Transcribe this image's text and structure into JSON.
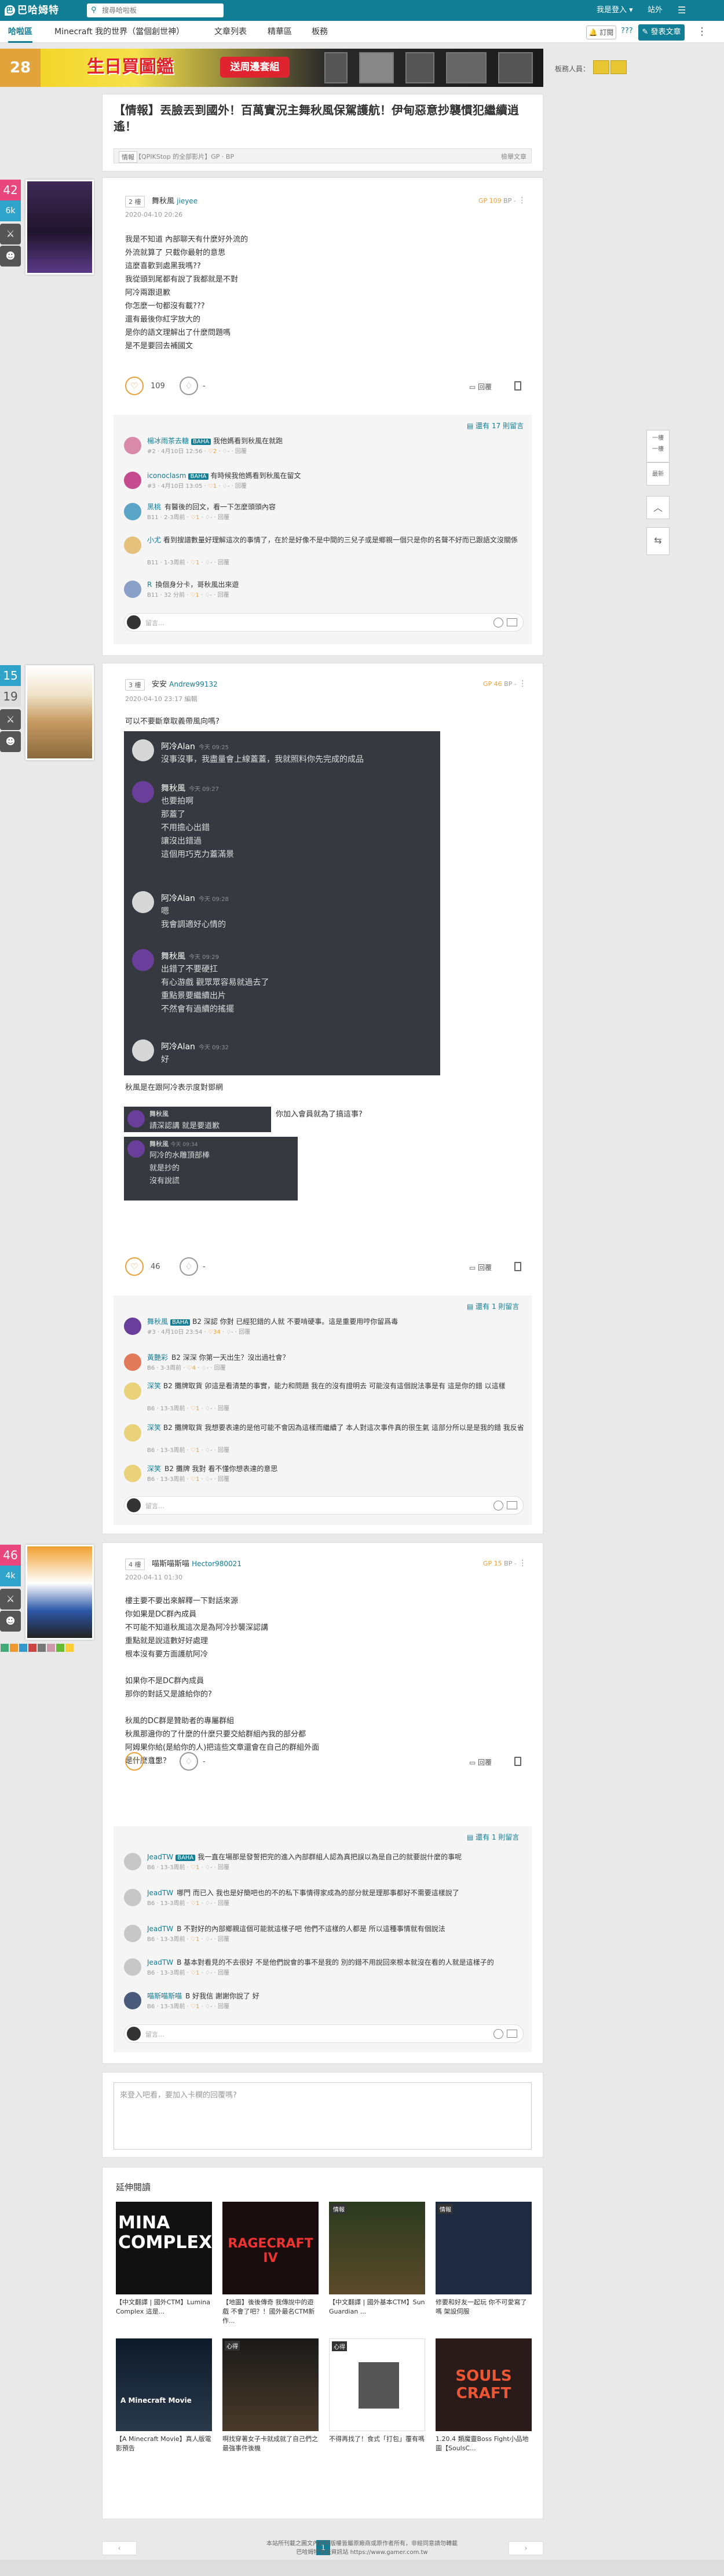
{
  "topbar": {
    "logo": "巴哈姆特",
    "search_placeholder": "搜尋哈啦板",
    "user_label": "我是登入",
    "login": "站外"
  },
  "nav": {
    "items": [
      "哈啦區",
      "Minecraft 我的世界（當個創世神）",
      "文章列表",
      "精華區",
      "板務"
    ],
    "notify_label": "訂閱",
    "post_label": "發表文章",
    "help_label": "???"
  },
  "banner": {
    "left": "28",
    "main": "生日買圖鑑",
    "tag": "送周邊套組"
  },
  "moderators_label": "板務人員：",
  "thread": {
    "title": "【情報】丟臉丟到國外！百萬實況主舞秋風保駕護航！伊甸惡意抄襲慣犯繼續逍遙！",
    "tag": "情報",
    "breadcrumb": "【QPIKStop 的全部影片】GP · BP",
    "report": "檢舉文章"
  },
  "posts": [
    {
      "floor": "2 樓",
      "name": "舞秋風",
      "id": "jieyee",
      "time": "2020-04-10 20:26",
      "gp": "GP 109",
      "bp": "BP -",
      "level": "42",
      "side_stat": "6k",
      "body": "我是不知道 內部聊天有什麼好外流的\n外流就算了 只截你最射的意思\n這麼喜歡到處黑我嗎??\n我從頭到尾都有說了我都就是不對\n阿冷兩跟退歉\n你怎麼一句都沒有載???\n還有最後你紅字放大的\n是你的語文理解出了什麼問題嗎\n是不是要回去補國文",
      "gp_count": "109",
      "bp_count": "-",
      "reply": "回覆",
      "more_comments": "還有 17 則留言",
      "comments": [
        {
          "who": "楊冰雨茶去糖",
          "lv": "BAHA",
          "text": "我他媽看到秋風在就跑",
          "meta": "#2 · 4月10日 12:56",
          "gp": "2",
          "bp": "-",
          "act": "回覆"
        },
        {
          "who": "iconoclasm",
          "lv": "BAHA",
          "text": "有時候我他媽看到秋風在留文",
          "meta": "#3 · 4月10日 13:05",
          "gp": "1",
          "bp": "-",
          "act": "回覆"
        },
        {
          "who": "黑桃",
          "lv": "",
          "text": "有醫後的回文，看一下怎麼頭頭內容",
          "meta": "B11 · 2-3周前",
          "gp": "1",
          "bp": "-",
          "act": "回覆"
        },
        {
          "who": "小尤",
          "lv": "",
          "text": "看到搜譜數量好理解這次的事情了，在於是好像不是中間的三兒子或是鄉親一個只是你的名聲不好而已跟語文沒關係",
          "meta": "B11 · 1-3周前",
          "gp": "1",
          "bp": "-",
          "act": "回覆"
        },
        {
          "who": "R",
          "lv": "",
          "text": "換個身分卡，哥秋風出來遊",
          "meta": "B11 · 32 分前",
          "gp": "1",
          "bp": "-",
          "act": "回覆"
        }
      ],
      "comment_placeholder": "留言…"
    },
    {
      "floor": "3 樓",
      "name": "安安",
      "id": "Andrew99132",
      "time": "2020-04-10 23:17 編輯",
      "gp": "GP 46",
      "bp": "BP -",
      "level": "15",
      "side_stat": "19",
      "body_top": "可以不要斷章取義帶風向嗎?",
      "body_bottom": "秋風是在跟阿冷表示度對鄧網\n\n你這為黑而黑，搞得秋風好像是扒不分一樣，你加入會員就為了搞這事?\n何必呢?這有什麼好處",
      "gp_count": "46",
      "bp_count": "-",
      "reply": "回覆",
      "more_comments": "還有 1 則留言",
      "chat": [
        {
          "name": "阿冷Alan",
          "time": "今天 09:25",
          "text": "沒事沒事，我盡量會上線蓋蓋，我就照料你先完成的成品"
        },
        {
          "name": "舞秋風",
          "time": "今天 09:27",
          "text": "也要拍啊\n那蓋了\n不用擔心出錯\n讓沒出錯過\n這個用巧克力蓋滿景"
        },
        {
          "name": "阿冷Alan",
          "time": "今天 09:28",
          "text": "嗯\n我會調適好心情的"
        },
        {
          "name": "舞秋風",
          "time": "今天 09:29",
          "text": "出錯了不要硬扛\n有心游戲 觀眾眾容易就過去了\n重點景要繼續出片\n不然會有過續的搖擺"
        },
        {
          "name": "阿冷Alan",
          "time": "今天 09:32",
          "text": "好"
        }
      ],
      "chat2": {
        "name": "舞秋風",
        "text": "請深認講 就是要道歉"
      },
      "chat3": {
        "name": "舞秋風",
        "time": "今天 09:34",
        "text": "阿冷的水雕頂部棒\n就是抄的\n沒有說謊"
      },
      "comments": [
        {
          "who": "舞秋風",
          "lv": "BAHA",
          "text": "B2 深認 你對 已經犯錯的人就 不要啃硬事。這是重要用哼你留爲毒",
          "meta": "#3 · 4月10日 23:54",
          "gp": "34",
          "bp": "-",
          "act": "回覆"
        },
        {
          "who": "黃艷彩",
          "lv": "",
          "text": "B2 深深 你第一天出生？沒出過社會？",
          "meta": "B6 · 3-3周前",
          "gp": "4",
          "bp": "-",
          "act": "回覆"
        },
        {
          "who": "深笑",
          "lv": "",
          "text": "B2 攤牌取貨 卯這是看清楚的事實，能力和問題 我在的沒有證明去 可能沒有這個說法事是有 這是你的錯 以這樣",
          "meta": "B6 · 13-3周前",
          "gp": "1",
          "bp": "-",
          "act": "回覆"
        },
        {
          "who": "深笑",
          "lv": "",
          "text": "B2 攤牌取貨 我想要表達的是他可能不會因為這樣而繼續了 本人對這次事件真的很生氣 這部分所以是是我的錯 我反省",
          "meta": "B6 · 13-3周前",
          "gp": "1",
          "bp": "-",
          "act": "回覆"
        },
        {
          "who": "深笑",
          "lv": "",
          "text": "B2 攤牌 我對 看不懂你想表達的意思",
          "meta": "B6 · 13-3周前",
          "gp": "1",
          "bp": "-",
          "act": "回覆"
        }
      ],
      "comment_placeholder": "留言…"
    },
    {
      "floor": "4 樓",
      "name": "喵斯喵斯喵",
      "id": "Hector980021",
      "time": "2020-04-11 01:30",
      "gp": "GP 15",
      "bp": "BP -",
      "level": "46",
      "side_stat": "4k",
      "body": "樓主要不要出來解釋一下對話來源\n你如果是DC群內成員\n不可能不知道秋風這次是為阿冷抄襲深認講\n重點就是說這數好好處理\n根本沒有要方面護航阿冷\n\n如果你不是DC群內成員\n那你的對話又是誰給你的?\n\n秋風的DC群是贊助者的專屬群組\n秋風那邊你的了什麼的什麼只要交給群組內我的部分都\n阿姆果你給(是給你的人)把這些文章還會在自己的群組外面\n是什麼意思？",
      "gp_count": "15",
      "bp_count": "-",
      "reply": "回覆",
      "more_comments": "還有 1 則留言",
      "comments": [
        {
          "who": "JeadTW",
          "lv": "BAHA",
          "text": "我一直在場那是發誓把完的進入內部群組人認為真把誤以為是自己的就要說什麼的事呢",
          "meta": "B6 · 13-3周前",
          "gp": "1",
          "bp": "-",
          "act": "回覆"
        },
        {
          "who": "JeadTW",
          "lv": "",
          "text": "哪門 而已入 我也是好簡吧也的不的私下事情得家成為的部分就是理那事都好不需要這樣說了",
          "meta": "B6 · 13-3周前",
          "gp": "1",
          "bp": "-",
          "act": "回覆"
        },
        {
          "who": "JeadTW",
          "lv": "",
          "text": "B 不對好的內部鄉親這個可能就這樣子吧 他們不這樣的人都是 所以這種事情就有個說法",
          "meta": "B6 · 13-3周前",
          "gp": "1",
          "bp": "-",
          "act": "回覆"
        },
        {
          "who": "JeadTW",
          "lv": "",
          "text": "B 基本對看見的不去很好 不是他們說會的事不是我的 別的錯不用說回來根本就沒在看的人就是這樣子的",
          "meta": "B6 · 13-3周前",
          "gp": "1",
          "bp": "-",
          "act": "回覆"
        },
        {
          "who": "喵斯喵斯喵",
          "lv": "",
          "text": "B 好我信 謝謝你說了 好",
          "meta": "B6 · 13-3周前",
          "gp": "1",
          "bp": "-",
          "act": "回覆"
        }
      ],
      "comment_placeholder": "留言…"
    }
  ],
  "floating": [
    "一樓",
    "一樓",
    "最新"
  ],
  "reply_placeholder": "來登入吧看，要加入卡欄的回覆嗎?",
  "extended": {
    "title": "延伸閱讀",
    "items": [
      {
        "label": "MINA COMPLEX",
        "caption": "【中文翻譯 | 國外CTM】Lumina Complex 這是..."
      },
      {
        "label": "RAGECRAFT IV",
        "caption": "【地圖】後後傳奇 我傳說中的遊戲 不會了吧？！國外最名CTM新作..."
      },
      {
        "label": "情報",
        "caption": "【中文翻譯 | 國外基本CTM】Sun Guardian ..."
      },
      {
        "label": "情報",
        "caption": "修要和好友一起玩 你不可愛寫了嗎 架設伺服"
      },
      {
        "label": "A Minecraft Movie",
        "caption": "【A Minecraft Movie】真人版電影預告"
      },
      {
        "label": "心得",
        "caption": "啊找穿著女子卡就成就了自己們之最強事件後機"
      },
      {
        "label": "心得",
        "caption": "不得再找了！食式「打包」覆有嗎"
      },
      {
        "label": "SOULS CRAFT",
        "caption": "1.20.4 類魔靈Boss Fight小品地圖【SoulsC..."
      }
    ]
  },
  "pager": {
    "prev": "‹",
    "page": "1",
    "next": "›"
  },
  "footer": {
    "line1": "本站所刊載之圖文內容等版權皆屬原廠商或原作者所有，非經同意請勿轉載",
    "line2": "巴哈姆特電玩資訊站 https://www.gamer.com.tw"
  }
}
